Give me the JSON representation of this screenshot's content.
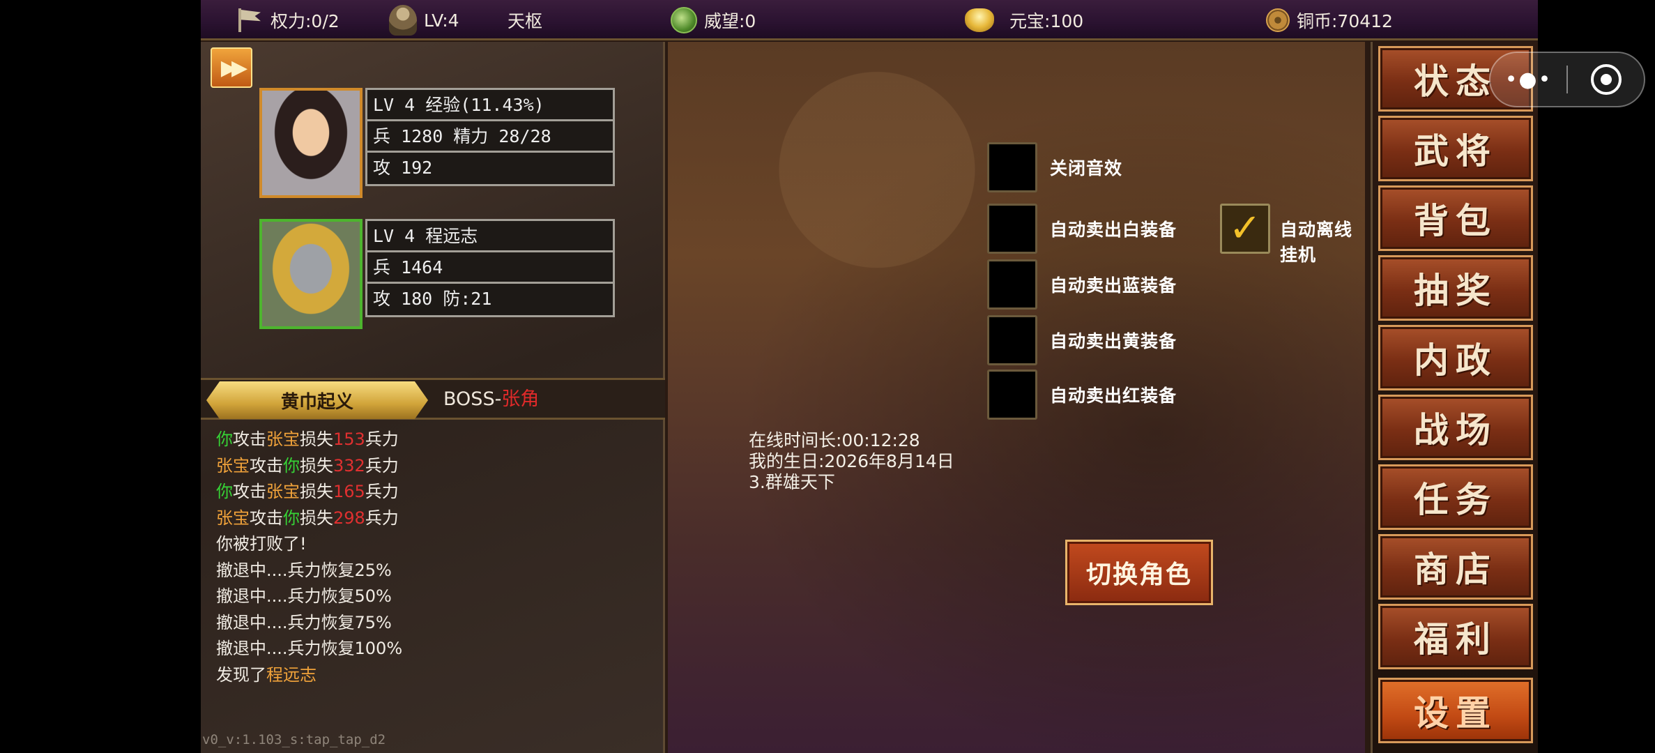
{
  "topbar": {
    "power": "权力:0/2",
    "level": "LV:4",
    "name": "天枢",
    "prestige": "威望:0",
    "yuanbao": "元宝:100",
    "copper": "铜币:70412"
  },
  "player": {
    "row1": "LV 4 经验(11.43%)",
    "row2": "兵 1280 精力 28/28",
    "row3": "攻 192"
  },
  "general": {
    "row1": "LV 4  程远志",
    "row2": "兵 1464",
    "row3": "攻 180 防:21"
  },
  "stage": {
    "tab": "黄巾起义",
    "boss_prefix": "BOSS-",
    "boss_name": "张角"
  },
  "log": [
    [
      "你",
      "攻击",
      "张宝",
      "损失",
      "153",
      "兵力"
    ],
    [
      "张宝",
      "攻击",
      "你",
      "损失",
      "332",
      "兵力"
    ],
    [
      "你",
      "攻击",
      "张宝",
      "损失",
      "165",
      "兵力"
    ],
    [
      "张宝",
      "攻击",
      "你",
      "损失",
      "298",
      "兵力"
    ],
    "你被打败了!",
    "撤退中....兵力恢复25%",
    "撤退中....兵力恢复50%",
    "撤退中....兵力恢复75%",
    "撤退中....兵力恢复100%",
    [
      "发现了",
      "程远志"
    ]
  ],
  "version": "v0_v:1.103_s:tap_tap_d2",
  "settings": {
    "close_sound": "关闭音效",
    "sell_white": "自动卖出白装备",
    "sell_blue": "自动卖出蓝装备",
    "sell_yellow": "自动卖出黄装备",
    "sell_red": "自动卖出红装备",
    "offline_idle": "自动离线挂机",
    "offline_idle_checked": true,
    "online_time": "在线时间长:00:12:28",
    "birthday": "我的生日:2026年8月14日",
    "server": "3.群雄天下",
    "switch_role": "切换角色"
  },
  "menu": [
    "状态",
    "武将",
    "背包",
    "抽奖",
    "内政",
    "战场",
    "任务",
    "商店",
    "福利",
    "设置"
  ],
  "menu_active": "设置",
  "capsule": {
    "more": "•●•"
  },
  "colors": {
    "ally": "#36d436",
    "enemy": "#f0a23a",
    "damage": "#e03030",
    "accent": "#c24a14"
  }
}
